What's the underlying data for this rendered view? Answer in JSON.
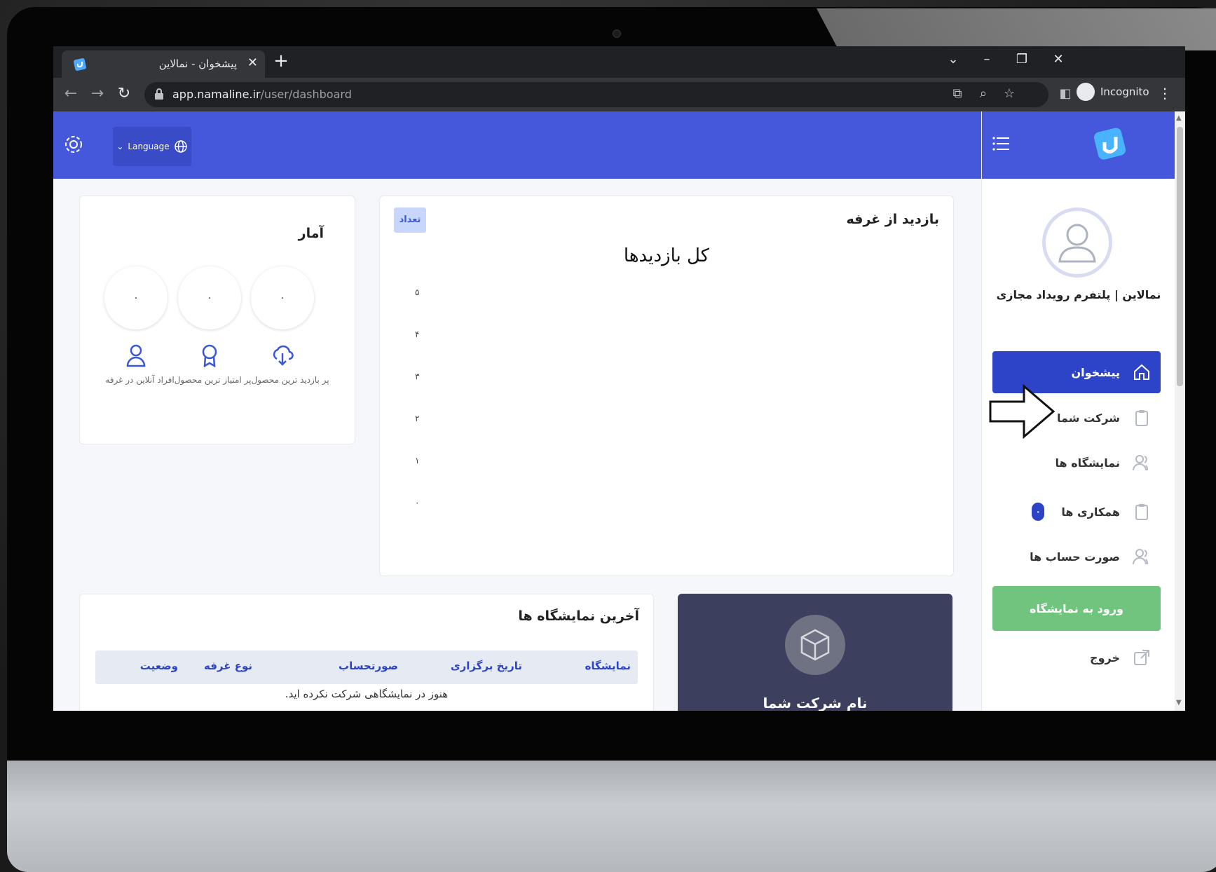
{
  "browser": {
    "tab_title": "پیشخوان - نمالاین",
    "url_host": "app.namaline.ir",
    "url_path": "/user/dashboard",
    "incognito_label": "Incognito"
  },
  "header": {
    "language_label": "Language"
  },
  "sidebar": {
    "org_name": "نمالاین | پلتفرم رویداد مجازی",
    "items": [
      {
        "label": "پیشخوان"
      },
      {
        "label": "شرکت شما"
      },
      {
        "label": "نمایشگاه ها"
      },
      {
        "label": "همکاری ها",
        "badge": "۰"
      },
      {
        "label": "صورت حساب ها"
      }
    ],
    "enter_exhibition": "ورود به نمایشگاه",
    "logout": "خروج"
  },
  "stats": {
    "title": "آمار",
    "values": [
      "۰",
      "۰",
      "۰"
    ],
    "labels": [
      "پر بازدید ترین محصول",
      "پر امتیاز ترین محصول",
      "افراد آنلاین در غرفه"
    ]
  },
  "visits": {
    "title": "بازدید از غرفه",
    "count_button": "تعداد",
    "chart_title": "کل بازدیدها"
  },
  "chart_data": {
    "type": "line",
    "title": "کل بازدیدها",
    "y_ticks": [
      "۵",
      "۴",
      "۳",
      "۲",
      "۱",
      "۰"
    ],
    "ylim": [
      0,
      5
    ],
    "series": []
  },
  "latest": {
    "title": "آخرین نمایشگاه ها",
    "columns": [
      "نمایشگاه",
      "تاریخ برگزاری",
      "صورتحساب",
      "نوع غرفه",
      "وضعیت"
    ],
    "empty_text": "هنوز در نمایشگاهی شرکت نکرده اید."
  },
  "company": {
    "name": "نام شرکت شما"
  },
  "colors": {
    "brand": "#4558db",
    "active": "#2d44c9",
    "green": "#71c47e"
  }
}
